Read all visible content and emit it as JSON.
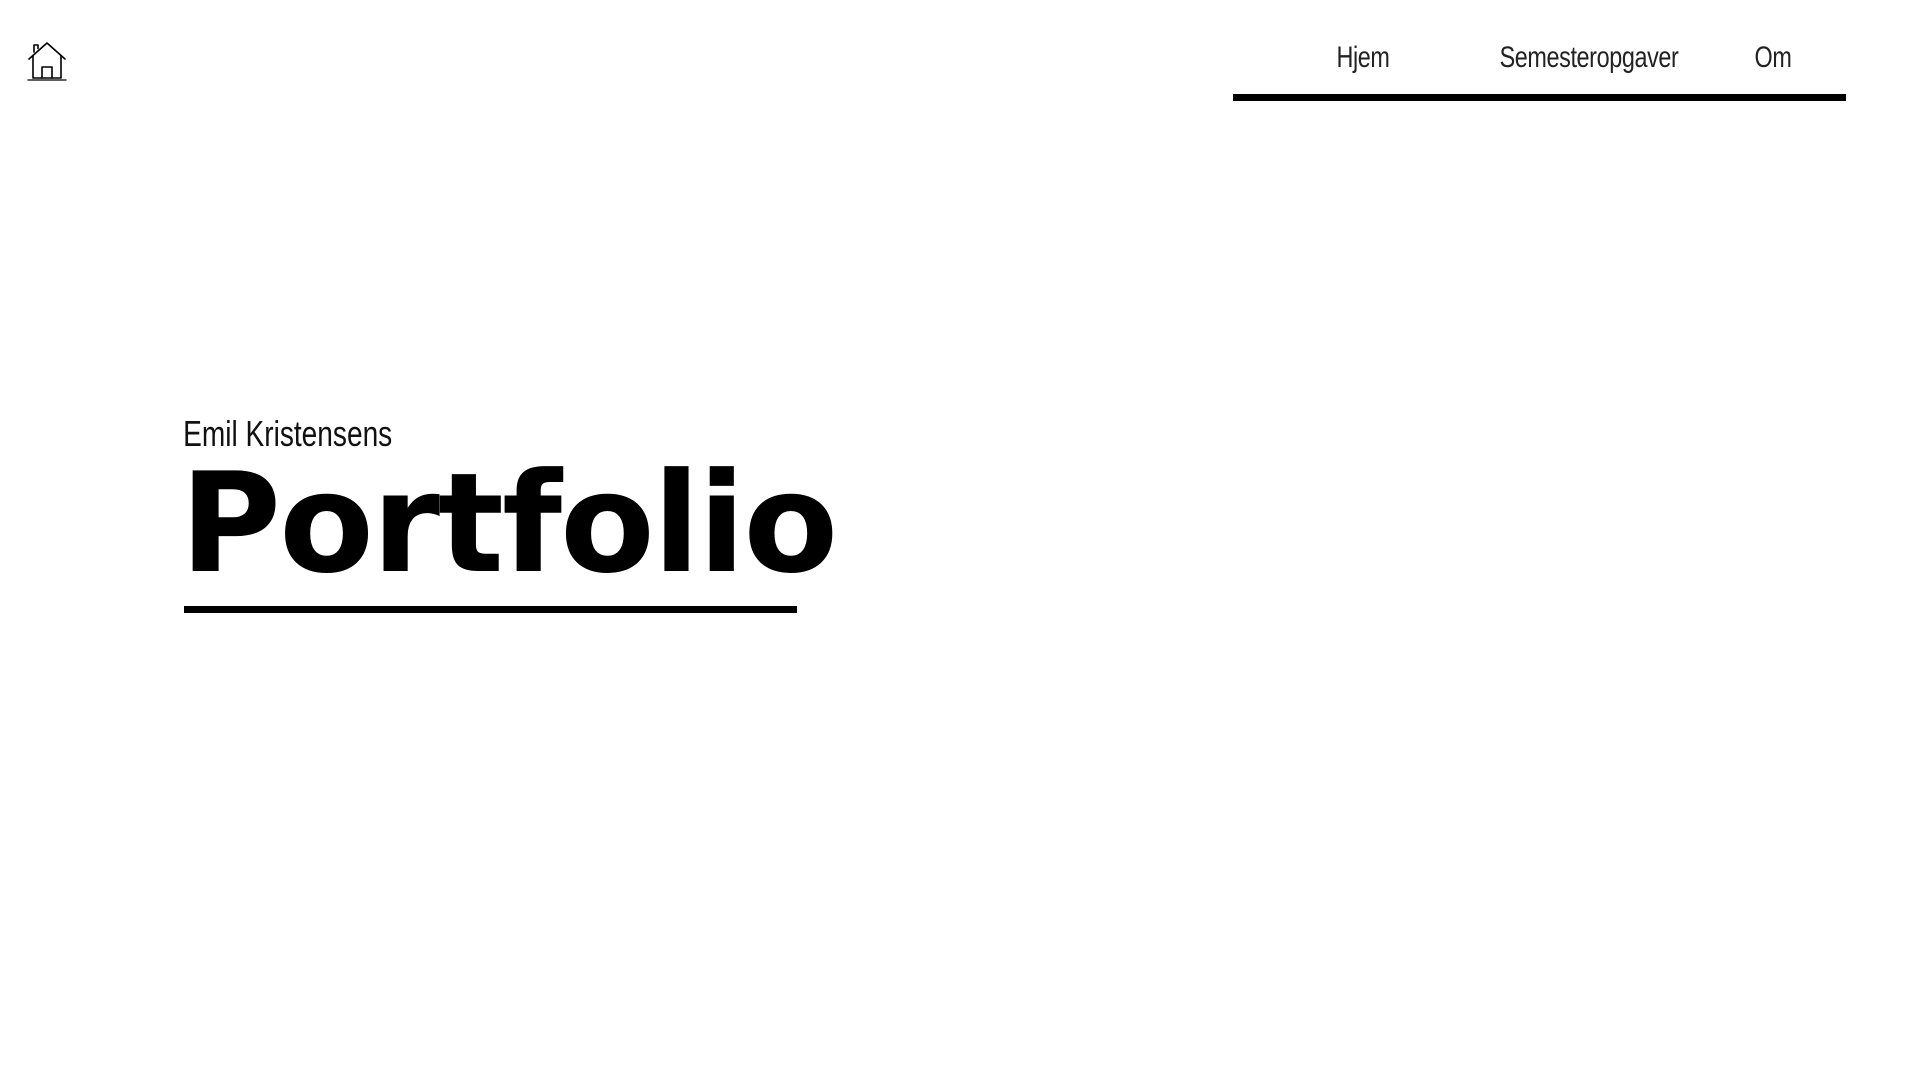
{
  "header": {
    "home_icon": "home-icon",
    "nav": {
      "items": [
        {
          "label": "Hjem"
        },
        {
          "label": "Semesteropgaver"
        },
        {
          "label": "Om"
        }
      ]
    }
  },
  "hero": {
    "subtitle": "Emil Kristensens",
    "title": "Portfolio"
  },
  "colors": {
    "background": "#ffffff",
    "text": "#000000",
    "accent_bar": "#000000"
  }
}
